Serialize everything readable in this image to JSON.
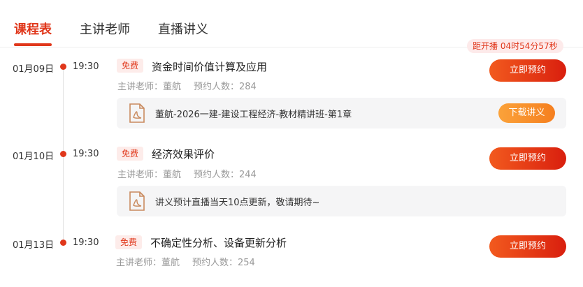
{
  "tabs": [
    {
      "label": "课程表"
    },
    {
      "label": "主讲老师"
    },
    {
      "label": "直播讲义"
    }
  ],
  "countdown": "距开播 04时54分57秒",
  "courses": [
    {
      "date": "01月09日",
      "time": "19:30",
      "badge": "免费",
      "title": "资金时间价值计算及应用",
      "teacher_label": "主讲老师：董航",
      "booking_label": "预约人数：284",
      "button": "立即预约",
      "handout_text": "董航-2026一建-建设工程经济-教材精讲班-第1章",
      "handout_button": "下载讲义"
    },
    {
      "date": "01月10日",
      "time": "19:30",
      "badge": "免费",
      "title": "经济效果评价",
      "teacher_label": "主讲老师：董航",
      "booking_label": "预约人数：244",
      "button": "立即预约",
      "handout_text": "讲义预计直播当天10点更新，敬请期待~"
    },
    {
      "date": "01月13日",
      "time": "19:30",
      "badge": "免费",
      "title": "不确定性分析、设备更新分析",
      "teacher_label": "主讲老师：董航",
      "booking_label": "预约人数：254",
      "button": "立即预约"
    }
  ],
  "colors": {
    "accent": "#e0371b",
    "download": "#f7901f",
    "handout_bg": "#f5f5f6"
  }
}
